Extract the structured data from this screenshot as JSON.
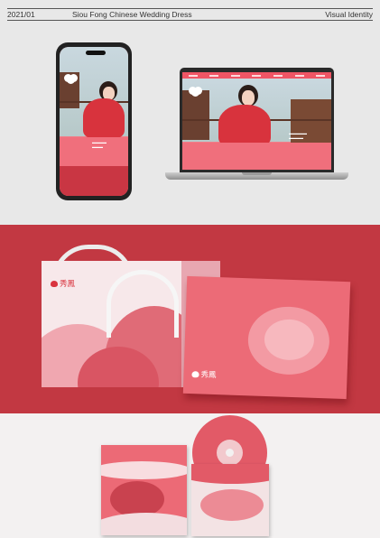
{
  "header": {
    "year_code": "2021/01",
    "project_title": "Siou Fong Chinese Wedding Dress",
    "category": "Visual Identity"
  },
  "brand": {
    "name_cn": "秀鳳"
  },
  "colors": {
    "brand_pink": "#f07d88",
    "brand_red": "#d9343f",
    "panel_red": "#c23842",
    "mockup_bg": "#e8e8e8",
    "cd_bg": "#f3f1f1"
  },
  "icons": [
    "peony-logo-icon"
  ]
}
